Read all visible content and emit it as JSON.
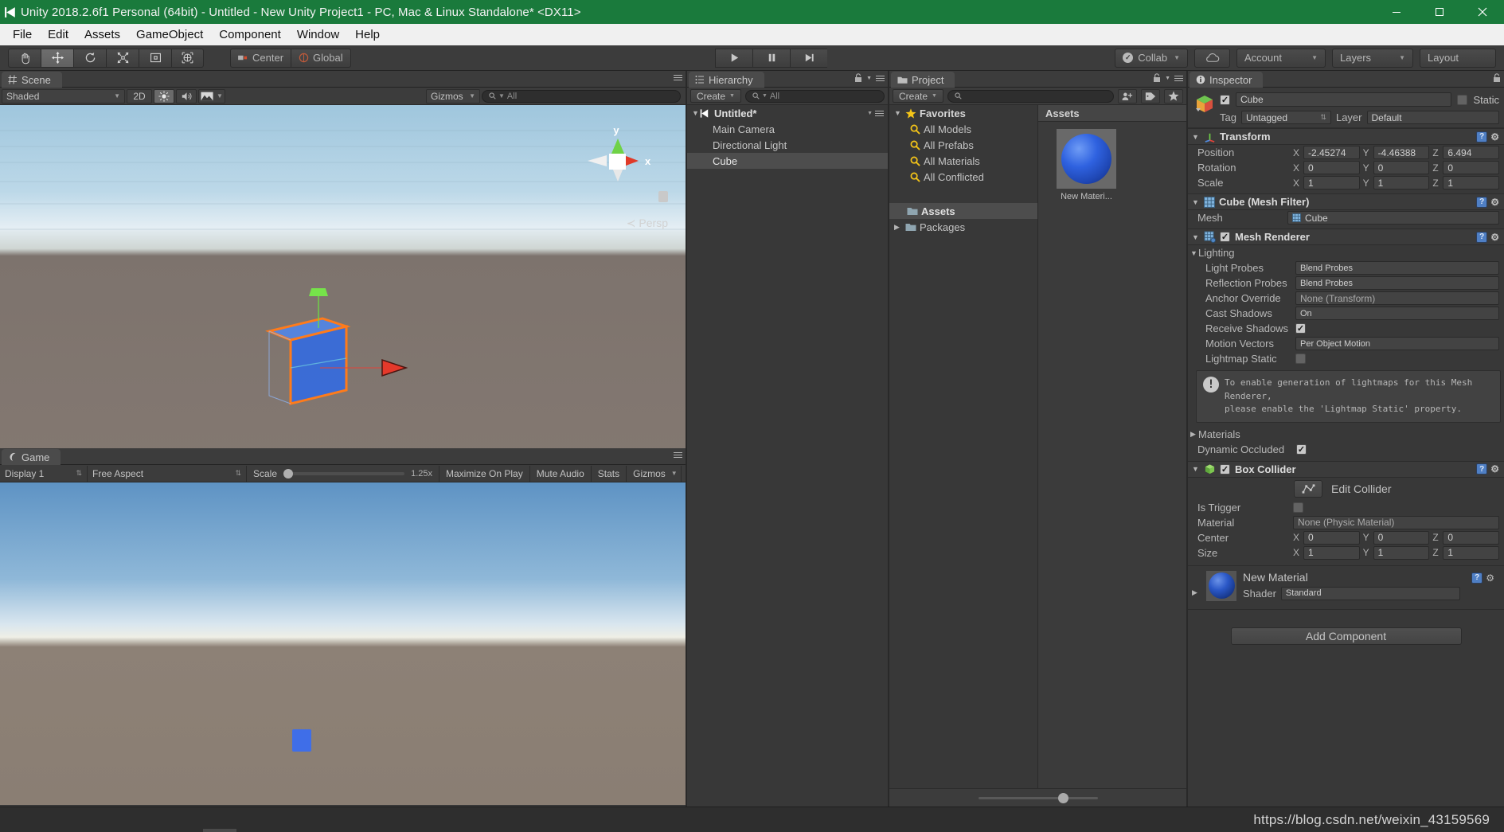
{
  "window": {
    "title": "Unity 2018.2.6f1 Personal (64bit) - Untitled - New Unity Project1 - PC, Mac & Linux Standalone* <DX11>",
    "minimize": "─",
    "maximize": "☐",
    "close": "✕"
  },
  "menubar": {
    "items": [
      "File",
      "Edit",
      "Assets",
      "GameObject",
      "Component",
      "Window",
      "Help"
    ]
  },
  "toolbar": {
    "transform_tools": [
      {
        "name": "hand-tool",
        "glyph": "✋",
        "active": false
      },
      {
        "name": "move-tool",
        "glyph": "✥",
        "active": true
      },
      {
        "name": "rotate-tool",
        "glyph": "↻",
        "active": false
      },
      {
        "name": "scale-tool",
        "glyph": "✥",
        "active": false
      },
      {
        "name": "rect-tool",
        "glyph": "⧉",
        "active": false
      },
      {
        "name": "transform-tool",
        "glyph": "✣",
        "active": false
      }
    ],
    "pivot_mode": "Center",
    "pivot_rotation": "Global",
    "play": "▶",
    "pause": "‖",
    "step": "▶|",
    "collab": "Collab",
    "cloud": "☁",
    "account": "Account",
    "layers": "Layers",
    "layout": "Layout"
  },
  "scene": {
    "tab": "Scene",
    "draw_mode": "Shaded",
    "two_d": "2D",
    "lighting_icon": "☀",
    "audio_icon": "◁)",
    "fx_icon": "◰",
    "gizmos": "Gizmos",
    "search_placeholder": "All",
    "camera_label": "Persp",
    "axis_x": "x",
    "axis_y": "y"
  },
  "game": {
    "tab": "Game",
    "display": "Display 1",
    "aspect": "Free Aspect",
    "scale_label": "Scale",
    "scale_value": "1.25x",
    "maximize_on_play": "Maximize On Play",
    "mute_audio": "Mute Audio",
    "stats": "Stats",
    "gizmos": "Gizmos"
  },
  "hierarchy": {
    "tab": "Hierarchy",
    "create": "Create",
    "search_placeholder": "All",
    "scene_name": "Untitled*",
    "items": [
      {
        "label": "Main Camera",
        "selected": false
      },
      {
        "label": "Directional Light",
        "selected": false
      },
      {
        "label": "Cube",
        "selected": true
      }
    ]
  },
  "project": {
    "tab": "Project",
    "create": "Create",
    "search_placeholder": "",
    "favorites_label": "Favorites",
    "favorites": [
      "All Models",
      "All Prefabs",
      "All Materials",
      "All Conflicted"
    ],
    "folders": [
      {
        "label": "Assets",
        "selected": true,
        "expandable": false
      },
      {
        "label": "Packages",
        "selected": false,
        "expandable": true
      }
    ],
    "assets_header": "Assets",
    "asset_item": "New Materi..."
  },
  "inspector": {
    "tab": "Inspector",
    "object_name": "Cube",
    "static_label": "Static",
    "tag_label": "Tag",
    "tag_value": "Untagged",
    "layer_label": "Layer",
    "layer_value": "Default",
    "transform": {
      "title": "Transform",
      "rows": [
        {
          "label": "Position",
          "x": "-2.45274",
          "y": "-4.46388",
          "z": "6.494"
        },
        {
          "label": "Rotation",
          "x": "0",
          "y": "0",
          "z": "0"
        },
        {
          "label": "Scale",
          "x": "1",
          "y": "1",
          "z": "1"
        }
      ]
    },
    "mesh_filter": {
      "title": "Cube (Mesh Filter)",
      "mesh_label": "Mesh",
      "mesh_value": "Cube"
    },
    "mesh_renderer": {
      "title": "Mesh Renderer",
      "lighting_label": "Lighting",
      "light_probes_label": "Light Probes",
      "light_probes_value": "Blend Probes",
      "reflection_probes_label": "Reflection Probes",
      "reflection_probes_value": "Blend Probes",
      "anchor_override_label": "Anchor Override",
      "anchor_override_value": "None (Transform)",
      "cast_shadows_label": "Cast Shadows",
      "cast_shadows_value": "On",
      "receive_shadows_label": "Receive Shadows",
      "motion_vectors_label": "Motion Vectors",
      "motion_vectors_value": "Per Object Motion",
      "lightmap_static_label": "Lightmap Static",
      "warning_line1": "To enable generation of lightmaps for this Mesh Renderer,",
      "warning_line2": "please enable the 'Lightmap Static' property.",
      "materials_label": "Materials",
      "dynamic_occluded_label": "Dynamic Occluded"
    },
    "box_collider": {
      "title": "Box Collider",
      "edit_collider": "Edit Collider",
      "is_trigger_label": "Is Trigger",
      "material_label": "Material",
      "material_value": "None (Physic Material)",
      "center_label": "Center",
      "center": {
        "x": "0",
        "y": "0",
        "z": "0"
      },
      "size_label": "Size",
      "size": {
        "x": "1",
        "y": "1",
        "z": "1"
      }
    },
    "material": {
      "title": "New Material",
      "shader_label": "Shader",
      "shader_value": "Standard"
    },
    "add_component": "Add Component"
  },
  "status": {
    "watermark": "https://blog.csdn.net/weixin_43159569"
  },
  "colors": {
    "titlebar": "#1a7a3c",
    "panel_bg": "#383838",
    "selection": "#4d4d4d",
    "accent_orange": "#ff7b1a",
    "cube_blue": "#2f62e0"
  }
}
